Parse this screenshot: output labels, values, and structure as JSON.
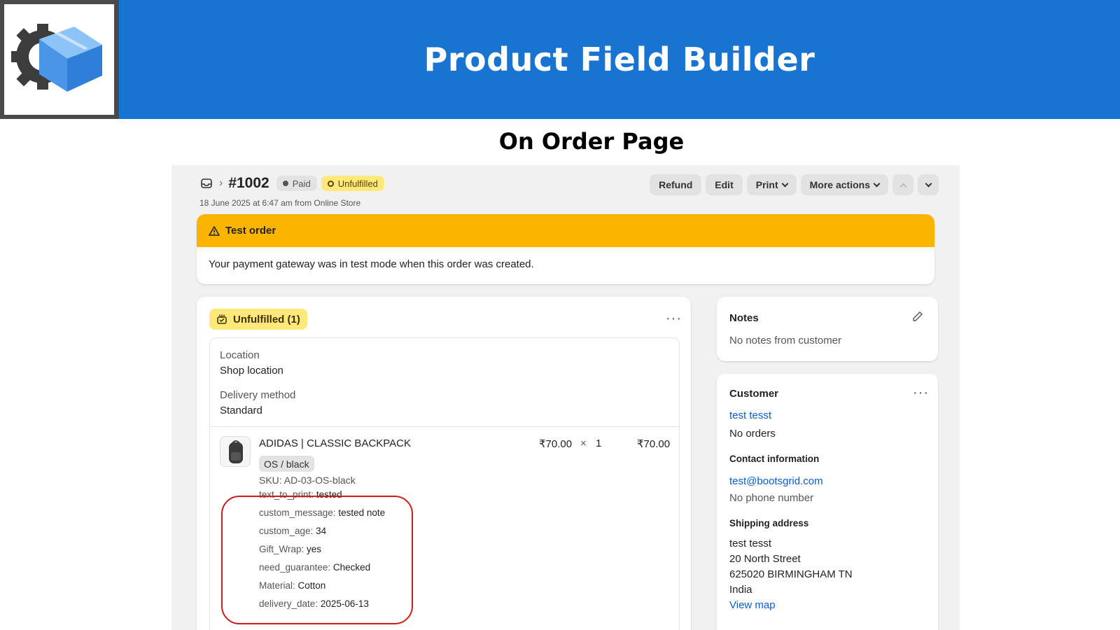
{
  "banner": {
    "title": "Product Field Builder",
    "subtitle": "On Order Page",
    "bg_color": "#1874d0",
    "logo_icon": "gear-box-icon"
  },
  "order": {
    "number": "#1002",
    "paid_badge": "Paid",
    "fulfillment_badge": "Unfulfilled",
    "meta": "18 June 2025 at 6:47 am from Online Store",
    "actions": {
      "refund": "Refund",
      "edit": "Edit",
      "print": "Print",
      "more": "More actions"
    }
  },
  "test_banner": {
    "title": "Test order",
    "message": "Your payment gateway was in test mode when this order was created.",
    "color": "#fbb500"
  },
  "fulfillment": {
    "status": "Unfulfilled (1)",
    "location_label": "Location",
    "location_value": "Shop location",
    "delivery_label": "Delivery method",
    "delivery_value": "Standard",
    "item": {
      "name": "ADIDAS | CLASSIC BACKPACK",
      "variant": "OS / black",
      "unit_price": "₹70.00",
      "times": "×",
      "quantity": "1",
      "total": "₹70.00",
      "sku": "SKU: AD-03-OS-black",
      "properties": [
        {
          "key": "text_to_print:",
          "value": "tested"
        },
        {
          "key": "custom_message:",
          "value": "tested note"
        },
        {
          "key": "custom_age:",
          "value": "34"
        },
        {
          "key": "Gift_Wrap:",
          "value": "yes"
        },
        {
          "key": "need_guarantee:",
          "value": "Checked"
        },
        {
          "key": "Material:",
          "value": "Cotton"
        },
        {
          "key": "delivery_date:",
          "value": "2025-06-13"
        }
      ]
    }
  },
  "notes": {
    "title": "Notes",
    "text": "No notes from customer"
  },
  "customer": {
    "title": "Customer",
    "name": "test tesst",
    "orders": "No orders",
    "contact_title": "Contact information",
    "email": "test@bootsgrid.com",
    "phone": "No phone number",
    "shipping_title": "Shipping address",
    "address": [
      "test tesst",
      "20 North Street",
      "625020 BIRMINGHAM TN",
      "India"
    ],
    "map_link": "View map"
  }
}
